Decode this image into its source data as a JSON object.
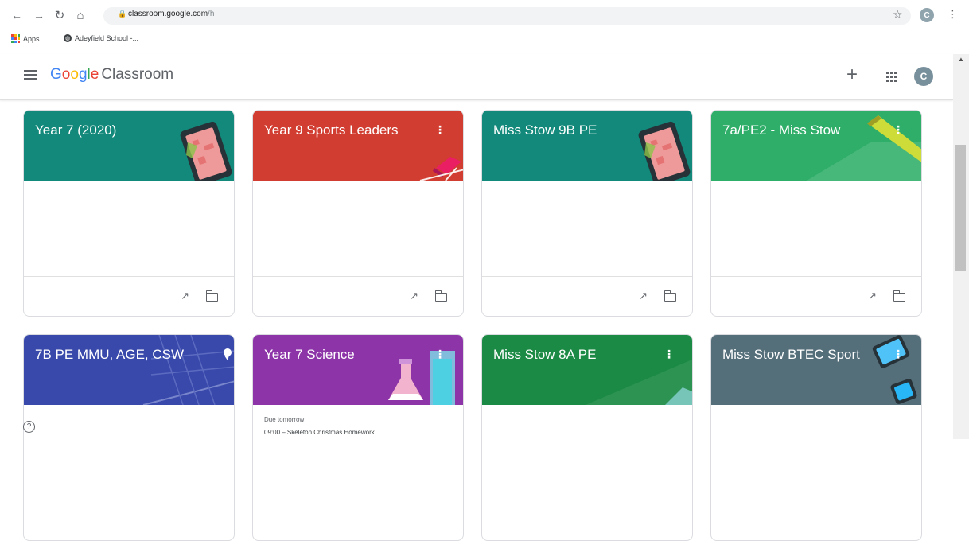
{
  "browser": {
    "url_host": "classroom.google.com",
    "url_path": "/h",
    "bookmarks": [
      {
        "label": "Apps"
      },
      {
        "label": "Adeyfield School -..."
      }
    ],
    "profile_initial": "C"
  },
  "header": {
    "logo_google": [
      "G",
      "o",
      "o",
      "g",
      "l",
      "e"
    ],
    "product": "Classroom",
    "account_initial": "C"
  },
  "classes": [
    {
      "title": "Year 7 (2020)",
      "color": "#12897a"
    },
    {
      "title": "Year 9 Sports Leaders",
      "color": "#d13d30"
    },
    {
      "title": "Miss Stow 9B PE",
      "color": "#12897a"
    },
    {
      "title": "7a/PE2 - Miss Stow",
      "color": "#2eae68"
    },
    {
      "title": "7B PE MMU, AGE, CSW",
      "color": "#3949ab"
    },
    {
      "title": "Year 7 Science",
      "color": "#8d35a8",
      "due_label": "Due tomorrow",
      "due_item": "09:00 – Skeleton Christmas Homework"
    },
    {
      "title": "Miss Stow 8A PE",
      "color": "#1b8a44"
    },
    {
      "title": "Miss Stow BTEC Sport",
      "color": "#546e7a"
    }
  ],
  "icons": {
    "trend": "trending-up-icon",
    "folder": "folder-icon",
    "help": "help-icon"
  },
  "help_glyph": "?"
}
